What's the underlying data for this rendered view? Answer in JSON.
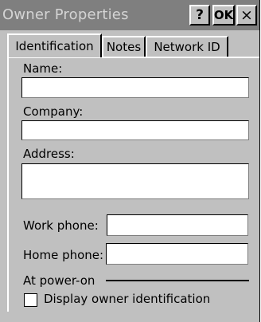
{
  "window": {
    "title": "Owner Properties",
    "help_label": "?",
    "ok_label": "OK",
    "close_label": "×"
  },
  "tabs": [
    {
      "label": "Identification",
      "selected": true
    },
    {
      "label": "Notes",
      "selected": false
    },
    {
      "label": "Network ID",
      "selected": false
    }
  ],
  "form": {
    "name_label": "Name:",
    "name_value": "",
    "company_label": "Company:",
    "company_value": "",
    "address_label": "Address:",
    "address_value": "",
    "work_phone_label": "Work phone:",
    "work_phone_value": "",
    "home_phone_label": "Home phone:",
    "home_phone_value": "",
    "power_on_label": "At power-on",
    "display_owner_label": "Display owner identification",
    "display_owner_checked": false
  },
  "colors": {
    "titlebar": "#7f7f7f",
    "dialog_bg": "#c0c0c0",
    "field_bg": "#ffffff"
  }
}
